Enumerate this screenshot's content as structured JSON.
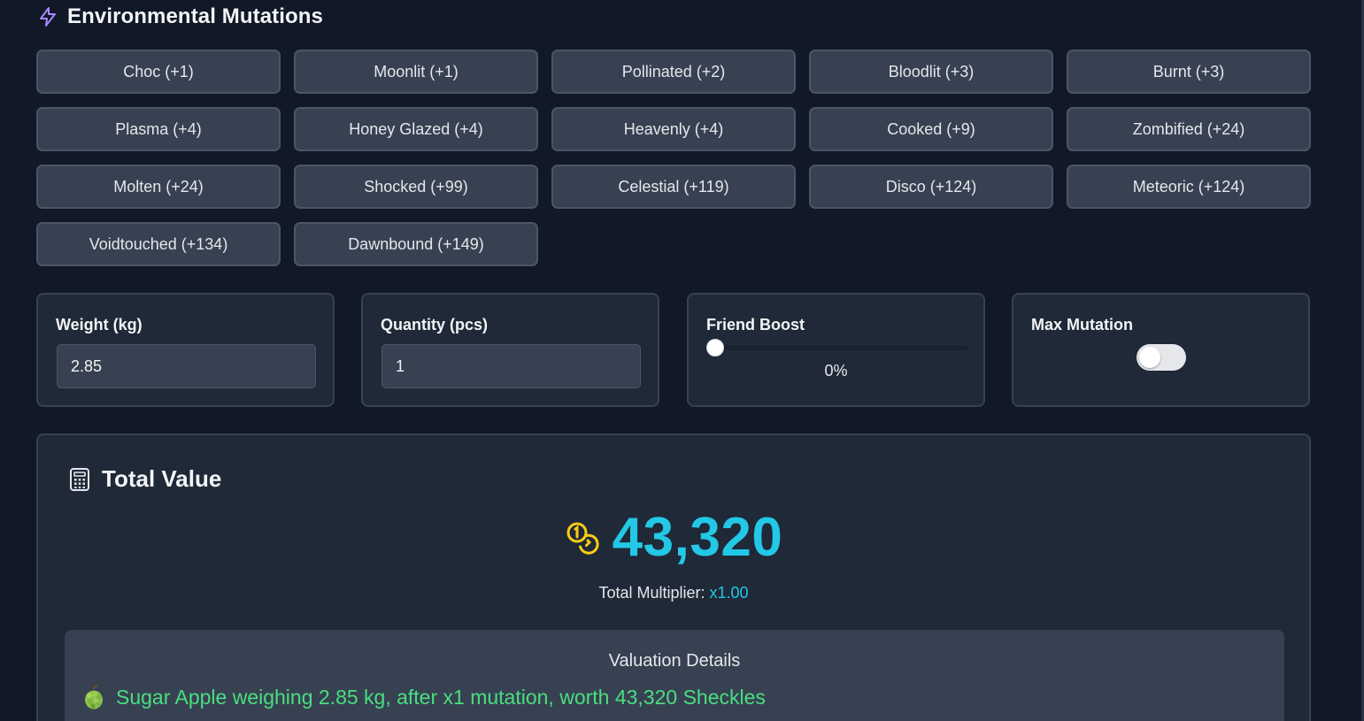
{
  "section": {
    "title": "Environmental Mutations",
    "icon": "lightning-icon"
  },
  "mutations": [
    "Choc (+1)",
    "Moonlit (+1)",
    "Pollinated (+2)",
    "Bloodlit (+3)",
    "Burnt (+3)",
    "Plasma (+4)",
    "Honey Glazed (+4)",
    "Heavenly (+4)",
    "Cooked (+9)",
    "Zombified (+24)",
    "Molten (+24)",
    "Shocked (+99)",
    "Celestial (+119)",
    "Disco (+124)",
    "Meteoric (+124)",
    "Voidtouched (+134)",
    "Dawnbound (+149)"
  ],
  "weight": {
    "label": "Weight (kg)",
    "value": "2.85"
  },
  "quantity": {
    "label": "Quantity (pcs)",
    "value": "1"
  },
  "friend_boost": {
    "label": "Friend Boost",
    "value_text": "0%",
    "level": 0
  },
  "max_mutation": {
    "label": "Max Mutation",
    "enabled": false
  },
  "total": {
    "title": "Total Value",
    "icon": "calculator-icon",
    "amount": "43,320",
    "coin_icon": "coins-icon",
    "multiplier_label": "Total Multiplier:",
    "multiplier_value": "x1.00"
  },
  "details": {
    "heading": "Valuation Details",
    "icon": "sugar-apple-icon",
    "text": "Sugar Apple weighing 2.85 kg, after x1 mutation, worth 43,320 Sheckles"
  },
  "colors": {
    "background": "#111827",
    "accent_cyan": "#22c8e6",
    "accent_purple": "#a78bfa",
    "accent_green": "#4ade80",
    "coin_yellow": "#facc15"
  }
}
